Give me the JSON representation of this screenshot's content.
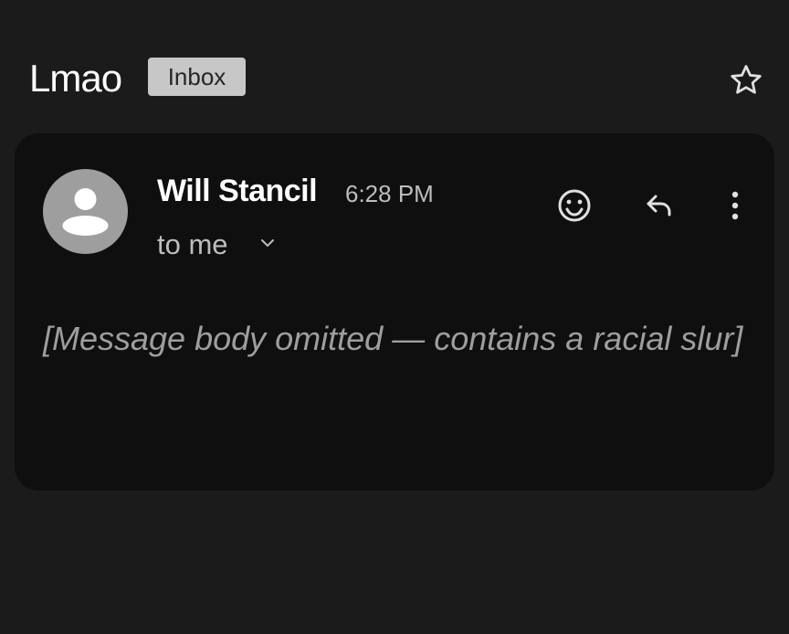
{
  "email": {
    "subject": "Lmao",
    "label": "Inbox",
    "sender": {
      "name": "Will Stancil",
      "time": "6:28 PM",
      "recipient_text": "to me"
    },
    "body": "[Message body omitted — contains a racial slur]"
  },
  "icons": {
    "star": "star-outline-icon",
    "avatar": "default-person-icon",
    "expand": "chevron-down-icon",
    "emoji": "emoji-reaction-icon",
    "reply": "reply-icon",
    "more": "more-vertical-icon"
  },
  "colors": {
    "page_background": "#1b1b1b",
    "card_background": "#0f0f0f",
    "label_chip": "#c7c7c7",
    "avatar": "#9e9e9e",
    "secondary_text": "#bdbdbd"
  }
}
